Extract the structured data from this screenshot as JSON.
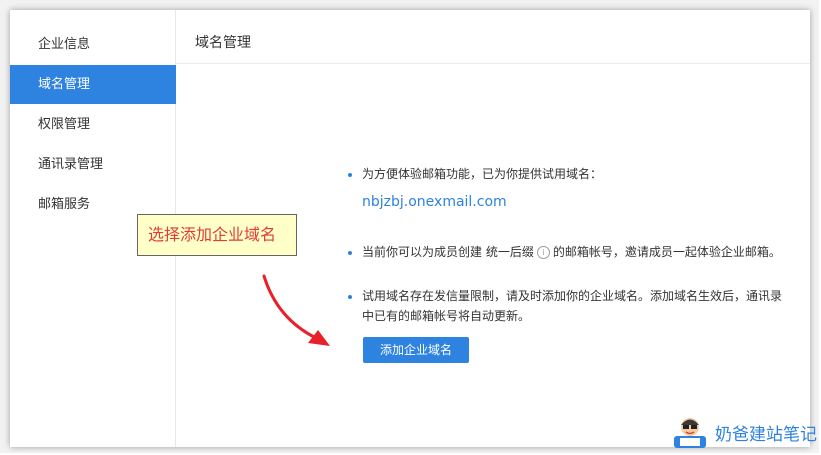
{
  "sidebar": {
    "items": [
      {
        "label": "企业信息",
        "active": false
      },
      {
        "label": "域名管理",
        "active": true
      },
      {
        "label": "权限管理",
        "active": false
      },
      {
        "label": "通讯录管理",
        "active": false
      },
      {
        "label": "邮箱服务",
        "active": false
      }
    ]
  },
  "main": {
    "title": "域名管理",
    "notice_1": "为方便体验邮箱功能，已为你提供试用域名：",
    "trial_domain": "nbjzbj.onexmail.com",
    "notice_2_part1": "当前你可以为成员创建  统一后缀",
    "notice_2_part2": "的邮箱帐号，邀请成员一起体验企业邮箱。",
    "notice_3_line1": "试用域名存在发信量限制，请及时添加你的企业域名。添加域名生效后，通讯录",
    "notice_3_line2": "中已有的邮箱帐号将自动更新。",
    "add_button_label": "添加企业域名"
  },
  "annotation": {
    "callout_text": "选择添加企业域名"
  },
  "watermark": {
    "text": "奶爸建站笔记"
  },
  "colors": {
    "accent": "#2e82e0",
    "callout_bg": "#ffffc8",
    "callout_text": "#e23b3b",
    "arrow": "#e8202a"
  },
  "icons": {
    "info_circle": "info-icon",
    "avatar": "mascot-icon"
  }
}
